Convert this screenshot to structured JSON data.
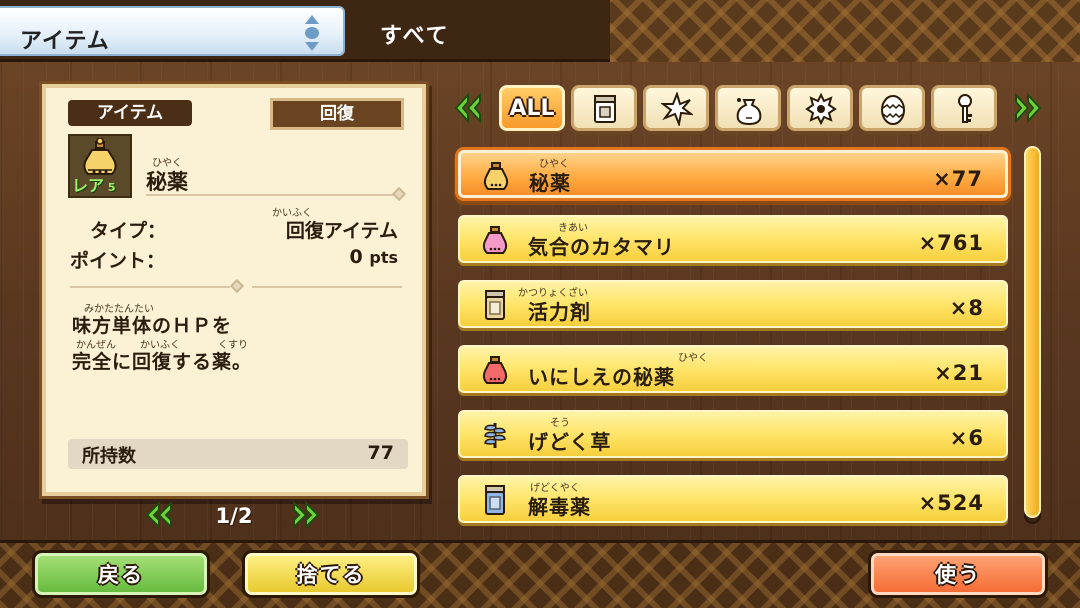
{
  "header": {
    "title": "アイテム",
    "category": "すべて"
  },
  "detail": {
    "tag": "アイテム",
    "category": "回復",
    "rarity_label": "レア",
    "rarity_value": "5",
    "item_name_ruby": "ひやく",
    "item_name": "秘薬",
    "type_label": "タイプ：",
    "type_ruby": "かいふく",
    "type_value": "回復アイテム",
    "points_label": "ポイント：",
    "points_value": "0",
    "points_unit": "pts",
    "desc_line1_ruby": "みかたたんたい",
    "desc_line1": "味方単体のＨＰを",
    "desc_line2_ruby_a": "かんぜん",
    "desc_line2_ruby_b": "かいふく",
    "desc_line2_ruby_c": "くすり",
    "desc_line2": "完全に回復する薬。",
    "owned_label": "所持数",
    "owned_value": "77"
  },
  "pager": {
    "text": "1/2"
  },
  "filter_tabs": {
    "all_label": "ALL",
    "icons": [
      "all-icon",
      "potion-box-icon",
      "burst-icon",
      "pouch-icon",
      "spiky-material-icon",
      "egg-icon",
      "key-icon"
    ]
  },
  "items": [
    {
      "ruby": "ひやく",
      "name": "秘薬",
      "qty": "×77",
      "icon": "bottle-icon",
      "icon_color": "#f5d26a",
      "selected": true
    },
    {
      "ruby": "きあい",
      "name": "気合のカタマリ",
      "qty": "×761",
      "icon": "bottle-icon",
      "icon_color": "#f59ac8",
      "selected": false
    },
    {
      "ruby": "かつりょくざい",
      "name": "活力剤",
      "qty": "×8",
      "icon": "jar-icon",
      "icon_color": "#e8d6a0",
      "selected": false
    },
    {
      "ruby": "ひやく",
      "name": "いにしえの秘薬",
      "qty": "×21",
      "icon": "bottle-icon",
      "icon_color": "#f26a6a",
      "selected": false
    },
    {
      "ruby": "そう",
      "name": "げどく草",
      "qty": "×6",
      "icon": "herb-icon",
      "icon_color": "#8fb6e8",
      "selected": false
    },
    {
      "ruby": "げどくやく",
      "name": "解毒薬",
      "qty": "×524",
      "icon": "jar-icon",
      "icon_color": "#8fb6e8",
      "selected": false
    }
  ],
  "footer": {
    "back_label": "戻る",
    "discard_label": "捨てる",
    "use_label": "使う"
  },
  "colors": {
    "selected_row": "#f89a2c",
    "row": "#ffe56a",
    "back_button": "#62b93a",
    "discard_button": "#e6c627",
    "use_button": "#f4682f"
  }
}
